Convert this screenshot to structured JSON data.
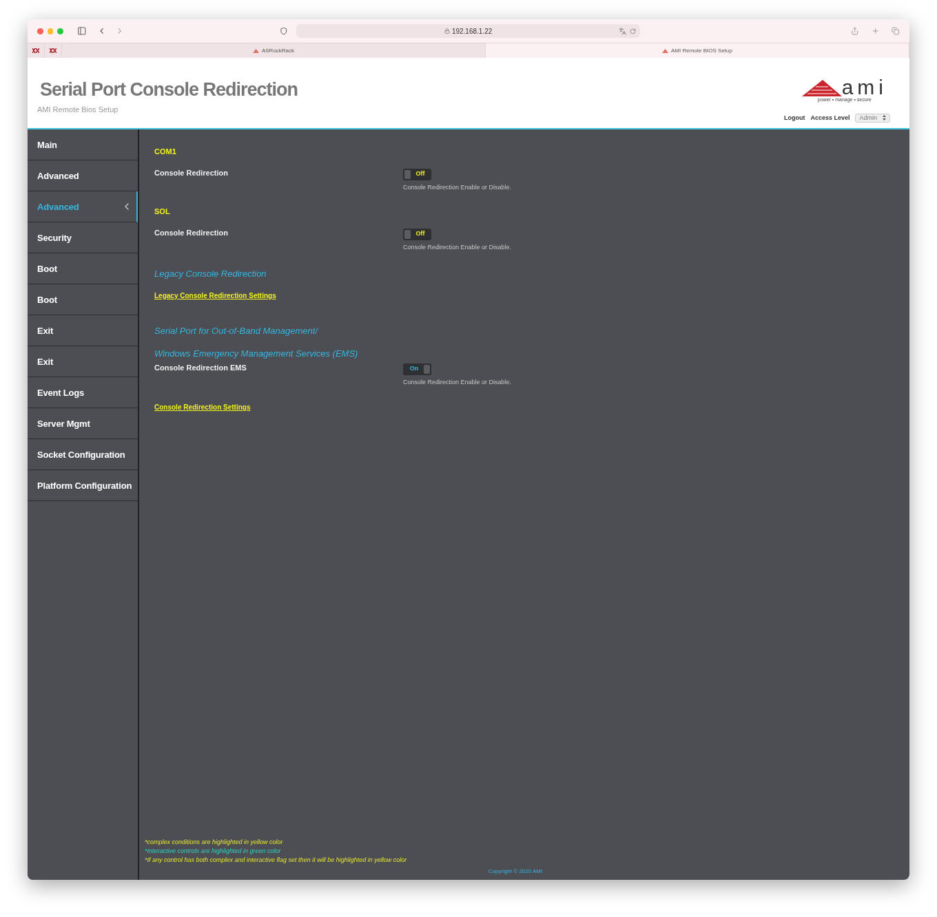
{
  "browser": {
    "url": "192.168.1.22",
    "tabs": [
      {
        "title": "ASRockRack",
        "selected": false
      },
      {
        "title": "AMI Remote BIOS Setup",
        "selected": true
      }
    ]
  },
  "header": {
    "title": "Serial Port Console Redirection",
    "subtitle": "AMI Remote Bios Setup",
    "logo_text": "ami",
    "logo_tagline": "power • manage • secure",
    "logout": "Logout",
    "access_level_label": "Access Level",
    "access_level_value": "Admin"
  },
  "sidebar": {
    "items": [
      {
        "label": "Main",
        "selected": false
      },
      {
        "label": "Advanced",
        "selected": false
      },
      {
        "label": "Advanced",
        "selected": true
      },
      {
        "label": "Security",
        "selected": false
      },
      {
        "label": "Boot",
        "selected": false
      },
      {
        "label": "Boot",
        "selected": false
      },
      {
        "label": "Exit",
        "selected": false
      },
      {
        "label": "Exit",
        "selected": false
      },
      {
        "label": "Event Logs",
        "selected": false
      },
      {
        "label": "Server Mgmt",
        "selected": false
      },
      {
        "label": "Socket Configuration",
        "selected": false
      },
      {
        "label": "Platform Configuration",
        "selected": false
      }
    ]
  },
  "content": [
    {
      "kind": "group",
      "text": "COM1"
    },
    {
      "kind": "setting",
      "label": "Console Redirection",
      "on": false,
      "state_label": "Off",
      "help": "Console Redirection Enable or Disable."
    },
    {
      "kind": "group",
      "text": "SOL"
    },
    {
      "kind": "setting",
      "label": "Console Redirection",
      "on": false,
      "state_label": "Off",
      "help": "Console Redirection Enable or Disable."
    },
    {
      "kind": "title",
      "text": "Legacy Console Redirection"
    },
    {
      "kind": "link",
      "text": "Legacy Console Redirection Settings"
    },
    {
      "kind": "title",
      "text": "Serial Port for Out-of-Band Management/"
    },
    {
      "kind": "title",
      "text": "Windows Emergency Management Services (EMS)"
    },
    {
      "kind": "setting",
      "label": "Console Redirection EMS",
      "on": true,
      "state_label": "On",
      "help": "Console Redirection Enable or Disable."
    },
    {
      "kind": "link",
      "text": "Console Redirection Settings"
    }
  ],
  "footer": {
    "notes": [
      {
        "text": "*complex conditions are highlighted in yellow color",
        "kind": "complex"
      },
      {
        "text": "*Interactive controls are highlighted in green color",
        "kind": "interactive"
      },
      {
        "text": "*If any control has both complex and interactive flag set then it will be highlighted in yellow color",
        "kind": "complex"
      }
    ],
    "copyright": "Copyright © 2020 AMI"
  }
}
